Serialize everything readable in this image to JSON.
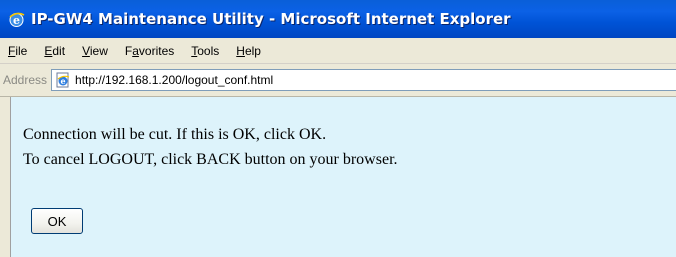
{
  "window": {
    "title": "IP-GW4 Maintenance Utility - Microsoft Internet Explorer"
  },
  "menu": {
    "items": [
      {
        "label": "File",
        "access_key_index": 0
      },
      {
        "label": "Edit",
        "access_key_index": 0
      },
      {
        "label": "View",
        "access_key_index": 0
      },
      {
        "label": "Favorites",
        "access_key_index": 1
      },
      {
        "label": "Tools",
        "access_key_index": 0
      },
      {
        "label": "Help",
        "access_key_index": 0
      }
    ]
  },
  "address_bar": {
    "label": "Address",
    "url": "http://192.168.1.200/logout_conf.html"
  },
  "page": {
    "message_line1": "Connection will be cut. If this is OK, click OK.",
    "message_line2": "To cancel LOGOUT, click BACK button on your browser.",
    "ok_label": "OK",
    "background_color": "#ddf3fb"
  },
  "icons": {
    "title_icon": "ie-logo-icon",
    "page_icon": "ie-page-icon"
  }
}
